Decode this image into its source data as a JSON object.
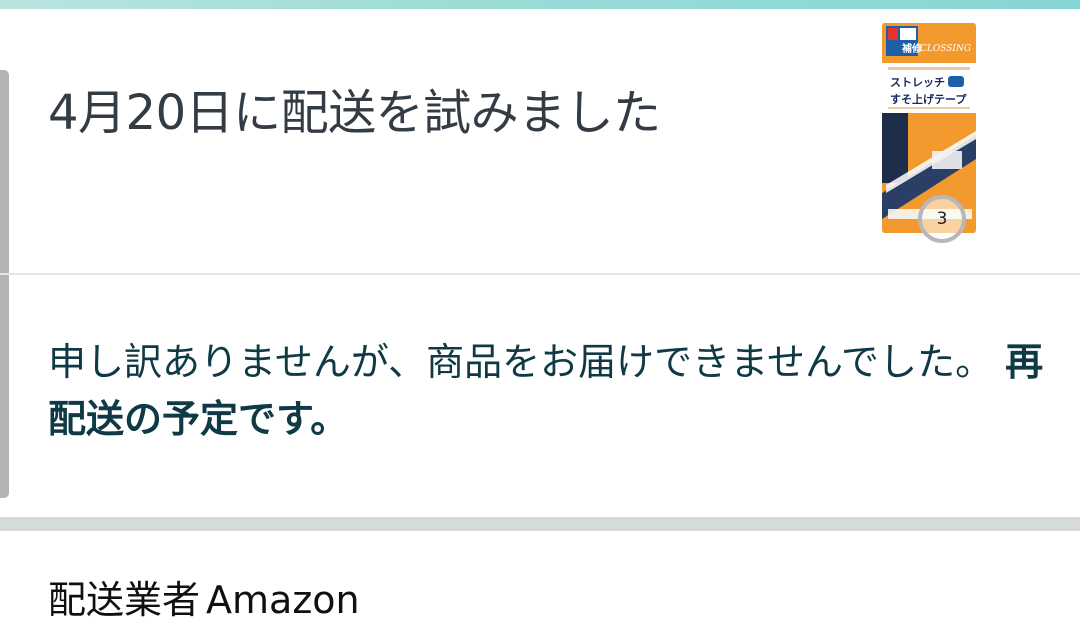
{
  "status": {
    "title": "4月20日に配送を試みました",
    "message": "申し訳ありませんが、商品をお届けできませんでした。",
    "message_strong": "再配送の予定です。"
  },
  "product": {
    "quantity": "3",
    "package_brand": "CLOSSING",
    "package_line1": "ストレッチ",
    "package_line2": "すそ上げテープ",
    "package_corner_label": "補修"
  },
  "carrier": {
    "label": "配送業者",
    "name": "Amazon"
  },
  "colors": {
    "accent": "#86d6d3",
    "title_text": "#333c45",
    "message_text": "#0f3a45",
    "package_orange": "#f39a2e"
  }
}
